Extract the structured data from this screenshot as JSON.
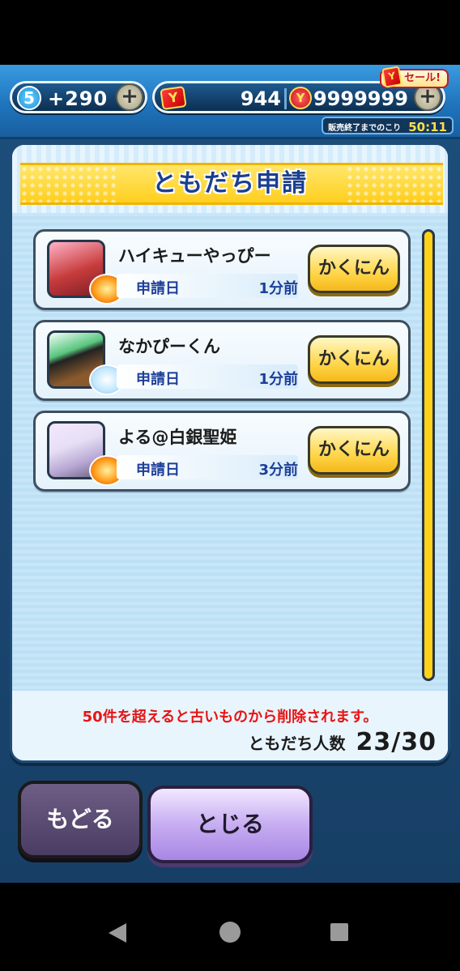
{
  "header": {
    "level": "5",
    "stamina": "+290",
    "tickets": "944",
    "coins": "9999999",
    "sale_label": "セール!",
    "sale_timer_label": "販売終了までのこり",
    "sale_timer_value": "50:11"
  },
  "dialog": {
    "title": "ともだち申請",
    "requests": [
      {
        "name": "ハイキューやっぴー",
        "date_label": "申請日",
        "date_value": "1分前",
        "button": "かくにん"
      },
      {
        "name": "なかぴーくん",
        "date_label": "申請日",
        "date_value": "1分前",
        "button": "かくにん"
      },
      {
        "name": "よる@白銀聖姫",
        "date_label": "申請日",
        "date_value": "3分前",
        "button": "かくにん"
      }
    ],
    "warning": "50件を超えると古いものから削除されます。",
    "friend_count_label": "ともだち人数",
    "friend_count_value": "23/30"
  },
  "buttons": {
    "back": "もどる",
    "close": "とじる"
  },
  "icons": {
    "stamina": "stamina-icon",
    "ticket": "ticket-icon",
    "coin": "coin-icon",
    "plus": "plus-icon"
  },
  "colors": {
    "accent_yellow": "#ffd21a",
    "warning_red": "#e81414",
    "label_blue": "#1d3f9a"
  }
}
